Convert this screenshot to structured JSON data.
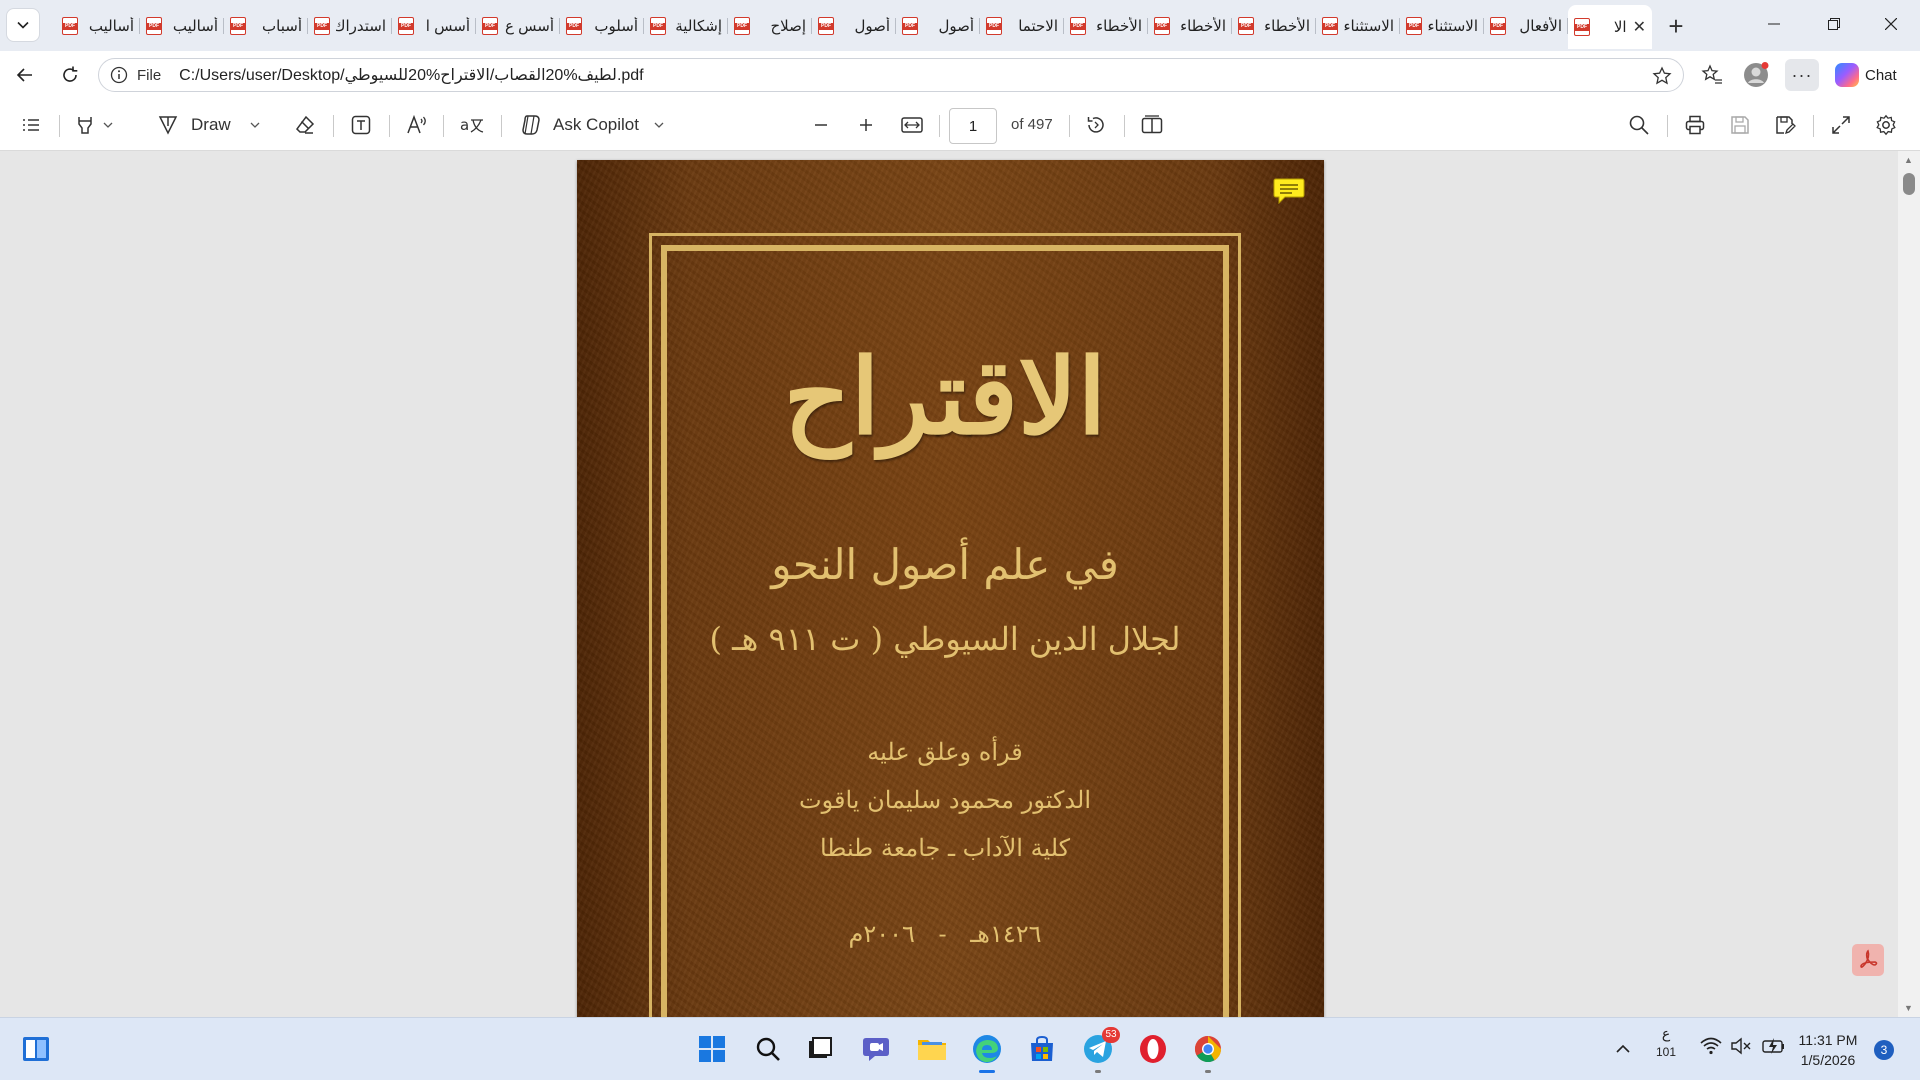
{
  "tabs": [
    {
      "title": "أساليب"
    },
    {
      "title": "أساليب"
    },
    {
      "title": "أسباب"
    },
    {
      "title": "استدراك"
    },
    {
      "title": "أسس ا"
    },
    {
      "title": "أسس ع"
    },
    {
      "title": "أسلوب"
    },
    {
      "title": "إشكالية"
    },
    {
      "title": "إصلاح"
    },
    {
      "title": "أصول"
    },
    {
      "title": "أصول"
    },
    {
      "title": "الاحتما"
    },
    {
      "title": "الأخطاء"
    },
    {
      "title": "الأخطاء"
    },
    {
      "title": "الأخطاء"
    },
    {
      "title": "الاستثناء"
    },
    {
      "title": "الاستثناء"
    },
    {
      "title": "الأفعال"
    },
    {
      "title": "الا"
    }
  ],
  "address": {
    "scheme_label": "File",
    "url": "C:/Users/user/Desktop/لطيف%20القصاب/الاقتراح%20للسيوطي.pdf"
  },
  "browser": {
    "chat_label": "Chat"
  },
  "pdf_toolbar": {
    "draw_label": "Draw",
    "ask_copilot_label": "Ask Copilot",
    "page_current": "1",
    "page_total_label": "of 497"
  },
  "cover": {
    "title": "الاقتراح",
    "subtitle": "في علم أصول النحو",
    "author": "لجلال الدين السيوطي ( ت ٩١١ هـ )",
    "read_by": "قرأه وعلق عليه",
    "editor": "الدكتور محمود سليمان ياقوت",
    "affiliation": "كلية الآداب ـ جامعة طنطا",
    "date": "١٤٢٦هـ - ٢٠٠٦م"
  },
  "taskbar": {
    "telegram_badge": "53",
    "input_lang_top": "ع",
    "input_lang_bottom": "101",
    "time": "11:31 PM",
    "date": "1/5/2026",
    "notification_count": "3"
  },
  "colors": {
    "cover_brown": "#6b3a10",
    "cover_gold": "#d7b463",
    "accent_blue": "#1a73e8"
  }
}
